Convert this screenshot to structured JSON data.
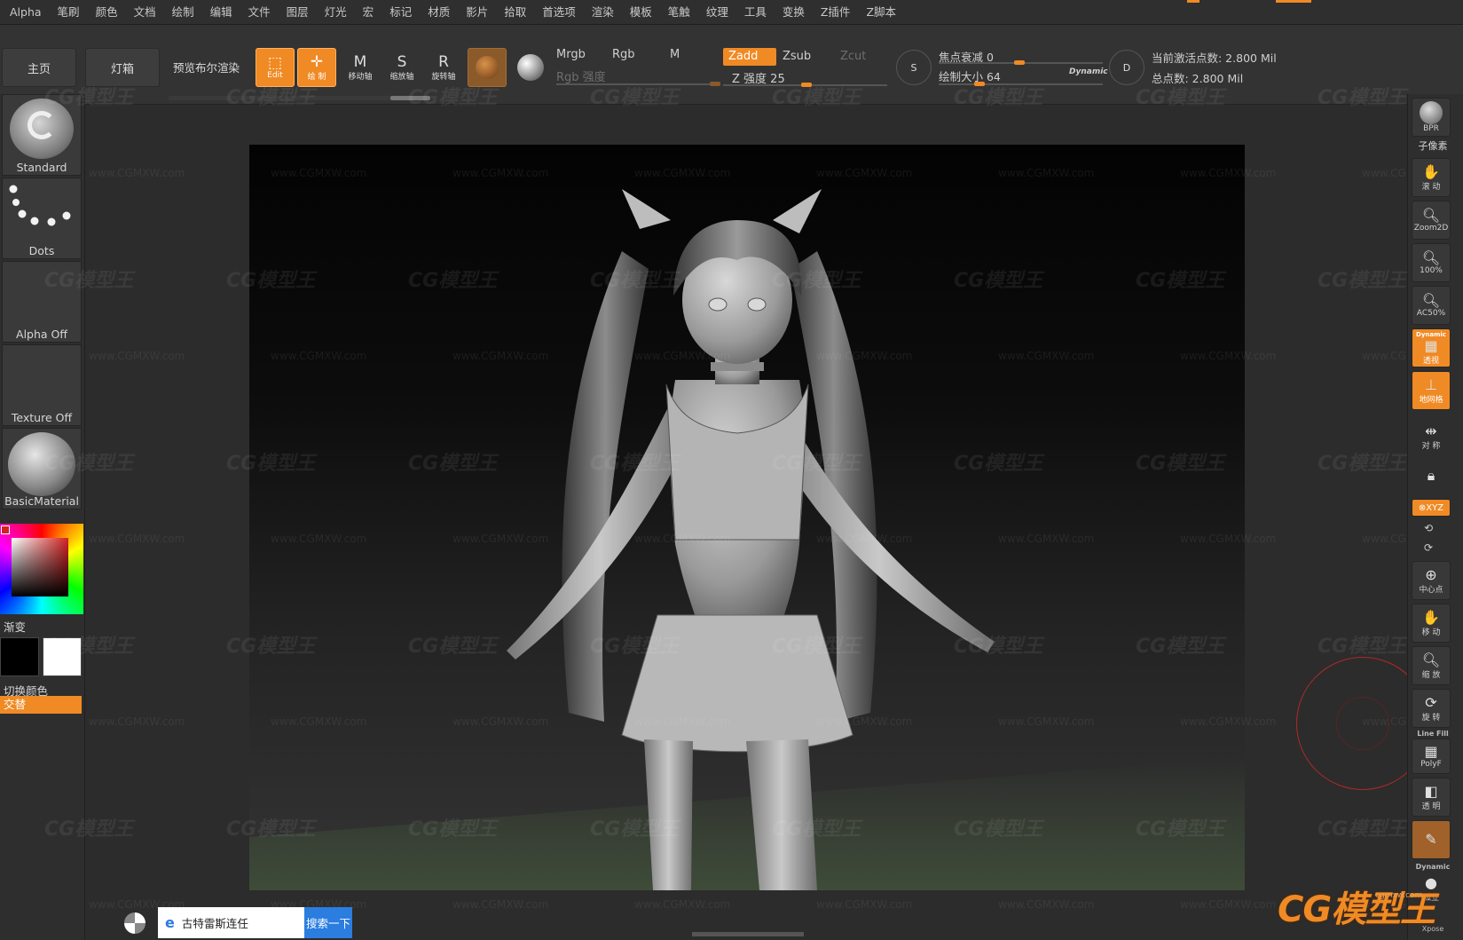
{
  "menu": {
    "items": [
      "Alpha",
      "笔刷",
      "颜色",
      "文档",
      "绘制",
      "编辑",
      "文件",
      "图层",
      "灯光",
      "宏",
      "标记",
      "材质",
      "影片",
      "拾取",
      "首选项",
      "渲染",
      "模板",
      "笔触",
      "纹理",
      "工具",
      "变换",
      "Z插件",
      "Z脚本"
    ]
  },
  "toolbar": {
    "home": "主页",
    "lightbox": "灯箱",
    "preview_bool": "预览布尔渲染",
    "edit": "Edit",
    "draw": "绘 制",
    "move": "移动轴",
    "scale": "缩放轴",
    "rotate": "旋转轴",
    "mrgb": "Mrgb",
    "rgb": "Rgb",
    "m": "M",
    "rgb_intensity": "Rgb 强度",
    "zadd": "Zadd",
    "zsub": "Zsub",
    "zcut": "Zcut",
    "z_intensity": "Z 强度 25",
    "s_label": "S",
    "d_label": "D",
    "focal_shift": "焦点衰减 0",
    "draw_size": "绘制大小 64",
    "dynamic": "Dynamic",
    "active_points": "当前激活点数: 2.800 Mil",
    "total_points": "总点数: 2.800 Mil",
    "focal_shift_value": 0,
    "draw_size_value": 64,
    "z_intensity_value": 25
  },
  "left": {
    "brush": "Standard",
    "stroke": "Dots",
    "alpha": "Alpha Off",
    "texture": "Texture Off",
    "material": "BasicMaterial",
    "gradient": "渐变",
    "switch_color": "切换颜色",
    "alternate": "交替"
  },
  "right": {
    "bpr": "BPR",
    "subpixel": "子像素",
    "scroll": "滚 动",
    "zoom2d": "Zoom2D",
    "zoom100": "100%",
    "ac50": "AC50%",
    "dynamic": "Dynamic",
    "persp": "透视",
    "floor": "地网格",
    "symmetry": "对 称",
    "xyz": "⊗XYZ",
    "center": "中心点",
    "move": "移 动",
    "zoom": "缩 放",
    "rotate": "旋 转",
    "linefill": "Line Fill",
    "polyf": "PolyF",
    "transp": "透 明",
    "dynamic2": "Dynamic",
    "solo": "孤立",
    "xpose": "Xpose"
  },
  "watermark": {
    "text": "CG模型王",
    "url": "www.CGMXW.com"
  },
  "taskbar": {
    "search_text": "古特雷斯连任",
    "search_button": "搜索一下"
  },
  "brand": {
    "logo": "CG模型王",
    "url": "cgmxw.com"
  },
  "colors": {
    "accent": "#f08a24",
    "panel": "#2e2e2e",
    "toolbar": "#333333"
  }
}
